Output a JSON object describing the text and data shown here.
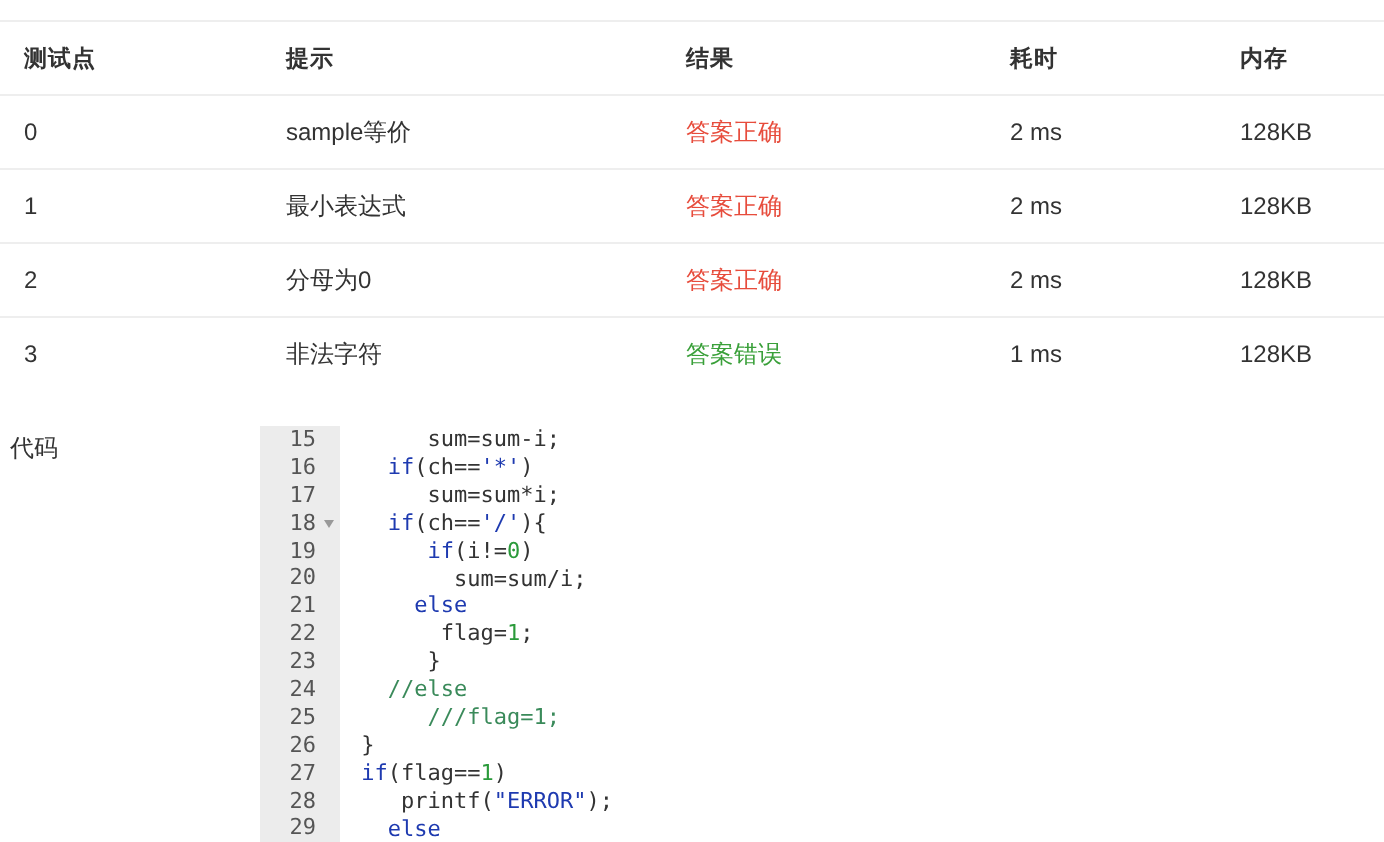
{
  "table": {
    "columns": [
      "测试点",
      "提示",
      "结果",
      "耗时",
      "内存"
    ],
    "rows": [
      {
        "case": "0",
        "hint": "sample等价",
        "result": "答案正确",
        "color": "#e74c3c",
        "time": "2 ms",
        "memory": "128KB"
      },
      {
        "case": "1",
        "hint": "最小表达式",
        "result": "答案正确",
        "color": "#e74c3c",
        "time": "2 ms",
        "memory": "128KB"
      },
      {
        "case": "2",
        "hint": "分母为0",
        "result": "答案正确",
        "color": "#e74c3c",
        "time": "2 ms",
        "memory": "128KB"
      },
      {
        "case": "3",
        "hint": "非法字符",
        "result": "答案错误",
        "color": "#3aa03a",
        "time": "1 ms",
        "memory": "128KB"
      }
    ]
  },
  "code": {
    "label": "代码",
    "lines": [
      {
        "number": "15",
        "fold": false,
        "tokens": [
          {
            "kind": "plain",
            "t": "      sum=sum-i;"
          }
        ]
      },
      {
        "number": "16",
        "fold": false,
        "tokens": [
          {
            "kind": "keyword",
            "t": "   if"
          },
          {
            "kind": "plain",
            "t": "(ch=="
          },
          {
            "kind": "string",
            "t": "'*'"
          },
          {
            "kind": "plain",
            "t": ")"
          }
        ]
      },
      {
        "number": "17",
        "fold": false,
        "tokens": [
          {
            "kind": "plain",
            "t": "      sum=sum*i;"
          }
        ]
      },
      {
        "number": "18",
        "fold": true,
        "tokens": [
          {
            "kind": "keyword",
            "t": "   if"
          },
          {
            "kind": "plain",
            "t": "(ch=="
          },
          {
            "kind": "string",
            "t": "'/'"
          },
          {
            "kind": "plain",
            "t": "){"
          }
        ]
      },
      {
        "number": "19",
        "fold": false,
        "tokens": [
          {
            "kind": "keyword",
            "t": "      if"
          },
          {
            "kind": "plain",
            "t": "(i!="
          },
          {
            "kind": "number",
            "t": "0"
          },
          {
            "kind": "plain",
            "t": ")"
          }
        ]
      },
      {
        "number": "20",
        "fold": false,
        "tokens": [
          {
            "kind": "plain",
            "t": "        sum=sum/i;"
          }
        ]
      },
      {
        "number": "21",
        "fold": false,
        "tokens": [
          {
            "kind": "keyword",
            "t": "     else"
          }
        ]
      },
      {
        "number": "22",
        "fold": false,
        "tokens": [
          {
            "kind": "plain",
            "t": "       flag="
          },
          {
            "kind": "number",
            "t": "1"
          },
          {
            "kind": "plain",
            "t": ";"
          }
        ]
      },
      {
        "number": "23",
        "fold": false,
        "tokens": [
          {
            "kind": "plain",
            "t": "      }"
          }
        ]
      },
      {
        "number": "24",
        "fold": false,
        "tokens": [
          {
            "kind": "comment",
            "t": "   //else"
          }
        ]
      },
      {
        "number": "25",
        "fold": false,
        "tokens": [
          {
            "kind": "comment",
            "t": "      ///flag=1;"
          }
        ]
      },
      {
        "number": "26",
        "fold": false,
        "tokens": [
          {
            "kind": "plain",
            "t": " }"
          }
        ]
      },
      {
        "number": "27",
        "fold": false,
        "tokens": [
          {
            "kind": "keyword",
            "t": " if"
          },
          {
            "kind": "plain",
            "t": "(flag=="
          },
          {
            "kind": "number",
            "t": "1"
          },
          {
            "kind": "plain",
            "t": ")"
          }
        ]
      },
      {
        "number": "28",
        "fold": false,
        "tokens": [
          {
            "kind": "plain",
            "t": "    printf("
          },
          {
            "kind": "string",
            "t": "\"ERROR\""
          },
          {
            "kind": "plain",
            "t": ");"
          }
        ]
      },
      {
        "number": "29",
        "fold": false,
        "tokens": [
          {
            "kind": "keyword",
            "t": "   else"
          }
        ]
      }
    ]
  }
}
